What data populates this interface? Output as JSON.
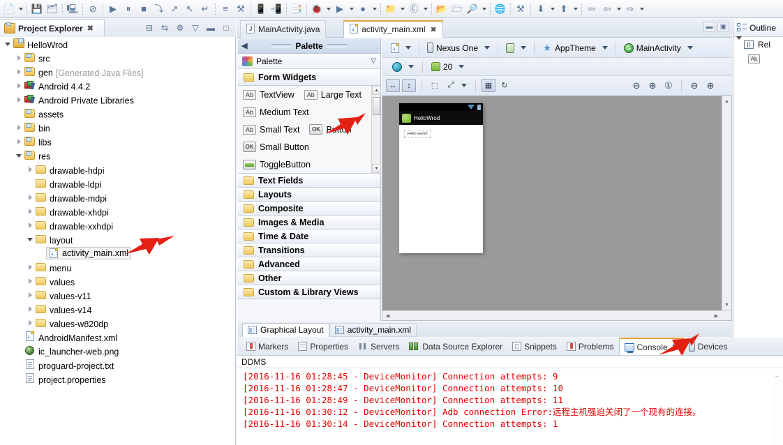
{
  "toolbar": {
    "groups": [
      {
        "items": [
          {
            "name": "new-wizard-icon",
            "glyph": "📄",
            "dropdown": true
          }
        ]
      },
      {
        "items": [
          {
            "name": "save-icon",
            "glyph": "💾",
            "dropdown": false
          },
          {
            "name": "save-all-icon",
            "glyph": "🗂",
            "dropdown": false
          }
        ]
      },
      {
        "items": [
          {
            "name": "print-icon",
            "glyph": "🖳",
            "dropdown": false
          }
        ]
      },
      {
        "items": [
          {
            "name": "toggle-breakpoint-icon",
            "glyph": "⊘",
            "dropdown": false
          }
        ]
      },
      {
        "items": [
          {
            "name": "resume-icon",
            "glyph": "▶",
            "dropdown": false
          },
          {
            "name": "suspend-icon",
            "glyph": "⏸",
            "dropdown": false
          },
          {
            "name": "terminate-icon",
            "glyph": "■",
            "dropdown": false
          },
          {
            "name": "step-into-icon",
            "glyph": "⤵",
            "dropdown": false
          },
          {
            "name": "step-over-icon",
            "glyph": "↗",
            "dropdown": false
          },
          {
            "name": "step-return-icon",
            "glyph": "↖",
            "dropdown": false
          },
          {
            "name": "drop-to-frame-icon",
            "glyph": "↵",
            "dropdown": false
          }
        ]
      },
      {
        "items": [
          {
            "name": "open-perspective-icon",
            "glyph": "≡",
            "dropdown": false
          },
          {
            "name": "android-sdk-manager-icon",
            "glyph": "⚒",
            "dropdown": false
          }
        ]
      },
      {
        "items": [
          {
            "name": "android-virtual-device-manager-icon",
            "glyph": "📱",
            "dropdown": false
          },
          {
            "name": "android-device-icon",
            "glyph": "📲",
            "dropdown": false
          }
        ]
      },
      {
        "items": [
          {
            "name": "new-xml-file-icon",
            "glyph": "📑",
            "dropdown": false
          }
        ]
      },
      {
        "items": [
          {
            "name": "debug-icon",
            "glyph": "🐞",
            "dropdown": true
          },
          {
            "name": "run-icon",
            "glyph": "▶",
            "dropdown": true
          },
          {
            "name": "coverage-icon",
            "glyph": "●",
            "dropdown": true
          }
        ]
      },
      {
        "items": [
          {
            "name": "new-android-project-icon",
            "glyph": "📁",
            "dropdown": true
          },
          {
            "name": "new-java-class-icon",
            "glyph": "Ⓒ",
            "dropdown": true
          }
        ]
      },
      {
        "items": [
          {
            "name": "open-type-icon",
            "glyph": "📂",
            "dropdown": false
          },
          {
            "name": "open-task-icon",
            "glyph": "🗁",
            "dropdown": false
          },
          {
            "name": "search-icon",
            "glyph": "🔎",
            "dropdown": true
          }
        ]
      },
      {
        "items": [
          {
            "name": "web-browser-icon",
            "glyph": "🌐",
            "dropdown": false
          }
        ]
      },
      {
        "items": [
          {
            "name": "run-last-tool-icon",
            "glyph": "⚒",
            "dropdown": false
          }
        ]
      },
      {
        "items": [
          {
            "name": "next-annotation-icon",
            "glyph": "⬇",
            "dropdown": true
          },
          {
            "name": "previous-annotation-icon",
            "glyph": "⬆",
            "dropdown": true
          }
        ]
      },
      {
        "items": [
          {
            "name": "back-icon",
            "glyph": "⇦",
            "dropdown": false
          },
          {
            "name": "previous-edit-icon",
            "glyph": "⇦",
            "dropdown": true
          },
          {
            "name": "forward-icon",
            "glyph": "⇨",
            "dropdown": true
          }
        ]
      }
    ]
  },
  "project_explorer": {
    "tab_label": "Project Explorer",
    "tab_close": "✖",
    "tools": [
      {
        "name": "collapse-all-icon",
        "glyph": "⊟"
      },
      {
        "name": "link-with-editor-icon",
        "glyph": "⇆"
      },
      {
        "name": "view-menu-filter-icon",
        "glyph": "⚙"
      },
      {
        "name": "view-menu-icon",
        "glyph": "▽"
      },
      {
        "name": "minimize-icon",
        "glyph": "▬"
      },
      {
        "name": "maximize-icon",
        "glyph": "□"
      }
    ],
    "tree": [
      {
        "label": "HelloWrod",
        "sub": "",
        "depth": 0,
        "twisty": "open",
        "icon": "android-project-icon",
        "selected": false
      },
      {
        "label": "src",
        "sub": "",
        "depth": 1,
        "twisty": "closed",
        "icon": "source-folder-icon",
        "selected": false
      },
      {
        "label": "gen",
        "sub": "[Generated Java Files]",
        "depth": 1,
        "twisty": "closed",
        "icon": "source-folder-icon",
        "selected": false
      },
      {
        "label": "Android 4.4.2",
        "sub": "",
        "depth": 1,
        "twisty": "closed",
        "icon": "library-icon",
        "selected": false
      },
      {
        "label": "Android Private Libraries",
        "sub": "",
        "depth": 1,
        "twisty": "closed",
        "icon": "library-icon",
        "selected": false
      },
      {
        "label": "assets",
        "sub": "",
        "depth": 1,
        "twisty": "none",
        "icon": "folder-res-icon",
        "selected": false
      },
      {
        "label": "bin",
        "sub": "",
        "depth": 1,
        "twisty": "closed",
        "icon": "folder-res-icon",
        "selected": false
      },
      {
        "label": "libs",
        "sub": "",
        "depth": 1,
        "twisty": "closed",
        "icon": "folder-res-icon",
        "selected": false
      },
      {
        "label": "res",
        "sub": "",
        "depth": 1,
        "twisty": "open",
        "icon": "folder-res-icon",
        "selected": false
      },
      {
        "label": "drawable-hdpi",
        "sub": "",
        "depth": 2,
        "twisty": "closed",
        "icon": "folder-icon",
        "selected": false
      },
      {
        "label": "drawable-ldpi",
        "sub": "",
        "depth": 2,
        "twisty": "none",
        "icon": "folder-icon",
        "selected": false
      },
      {
        "label": "drawable-mdpi",
        "sub": "",
        "depth": 2,
        "twisty": "closed",
        "icon": "folder-icon",
        "selected": false
      },
      {
        "label": "drawable-xhdpi",
        "sub": "",
        "depth": 2,
        "twisty": "closed",
        "icon": "folder-icon",
        "selected": false
      },
      {
        "label": "drawable-xxhdpi",
        "sub": "",
        "depth": 2,
        "twisty": "closed",
        "icon": "folder-icon",
        "selected": false
      },
      {
        "label": "layout",
        "sub": "",
        "depth": 2,
        "twisty": "open",
        "icon": "folder-icon",
        "selected": false
      },
      {
        "label": "activity_main.xml",
        "sub": "",
        "depth": 3,
        "twisty": "none",
        "icon": "xml-file-icon",
        "selected": true
      },
      {
        "label": "menu",
        "sub": "",
        "depth": 2,
        "twisty": "closed",
        "icon": "folder-icon",
        "selected": false
      },
      {
        "label": "values",
        "sub": "",
        "depth": 2,
        "twisty": "closed",
        "icon": "folder-icon",
        "selected": false
      },
      {
        "label": "values-v11",
        "sub": "",
        "depth": 2,
        "twisty": "closed",
        "icon": "folder-icon",
        "selected": false
      },
      {
        "label": "values-v14",
        "sub": "",
        "depth": 2,
        "twisty": "closed",
        "icon": "folder-icon",
        "selected": false
      },
      {
        "label": "values-w820dp",
        "sub": "",
        "depth": 2,
        "twisty": "closed",
        "icon": "folder-icon",
        "selected": false
      },
      {
        "label": "AndroidManifest.xml",
        "sub": "",
        "depth": 1,
        "twisty": "none",
        "icon": "xml-file-icon",
        "selected": false
      },
      {
        "label": "ic_launcher-web.png",
        "sub": "",
        "depth": 1,
        "twisty": "none",
        "icon": "image-file-icon",
        "selected": false
      },
      {
        "label": "proguard-project.txt",
        "sub": "",
        "depth": 1,
        "twisty": "none",
        "icon": "text-file-icon",
        "selected": false
      },
      {
        "label": "project.properties",
        "sub": "",
        "depth": 1,
        "twisty": "none",
        "icon": "text-file-icon",
        "selected": false
      }
    ]
  },
  "editor": {
    "tabs": [
      {
        "label": "MainActivity.java",
        "icon": "java-file-icon",
        "active": false,
        "closable": false
      },
      {
        "label": "activity_main.xml",
        "icon": "xml-file-icon",
        "active": true,
        "closable": true
      }
    ],
    "close_glyph": "✖",
    "window_buttons": [
      {
        "name": "minimize-editor-icon",
        "glyph": "▬"
      },
      {
        "name": "maximize-editor-icon",
        "glyph": "▣"
      }
    ],
    "bottom_tabs": [
      {
        "label": "Graphical Layout",
        "icon": "graphical-layout-icon",
        "active": true
      },
      {
        "label": "activity_main.xml",
        "icon": "xml-source-icon",
        "active": false
      }
    ]
  },
  "palette": {
    "header_title": "Palette",
    "left_arrow": "◀",
    "sub_title": "Palette",
    "sub_menu_glyph": "▽",
    "group_title": "Form Widgets",
    "widgets": [
      [
        {
          "label": "TextView",
          "kind": "ab"
        },
        {
          "label": "Large Text",
          "kind": "ab"
        }
      ],
      [
        {
          "label": "Medium Text",
          "kind": "ab"
        }
      ],
      [
        {
          "label": "Small Text",
          "kind": "ab"
        },
        {
          "label": "Button",
          "kind": "ok"
        }
      ],
      [
        {
          "label": "Small Button",
          "kind": "ok"
        }
      ],
      [
        {
          "label": "ToggleButton",
          "kind": "toggle"
        }
      ]
    ],
    "scroll_up": "▲",
    "scroll_down": "▼",
    "categories": [
      "Text Fields",
      "Layouts",
      "Composite",
      "Images & Media",
      "Time & Date",
      "Transitions",
      "Advanced",
      "Other",
      "Custom & Library Views"
    ]
  },
  "config_bar": {
    "row1": [
      {
        "name": "configuration-chooser-icon",
        "type": "icon-dropdown",
        "icon": "xml-config-icon",
        "label": ""
      },
      {
        "name": "device-selector",
        "type": "labeled-dropdown",
        "icon": "phone-icon",
        "label": "Nexus One"
      },
      {
        "name": "orientation-selector",
        "type": "icon-dropdown",
        "icon": "orientation-icon",
        "label": ""
      },
      {
        "name": "theme-selector",
        "type": "labeled-dropdown",
        "icon": "star-icon",
        "label": "AppTheme"
      },
      {
        "name": "activity-selector",
        "type": "labeled-dropdown",
        "icon": "activity-icon",
        "label": "MainActivity"
      }
    ],
    "row2": [
      {
        "name": "locale-selector",
        "type": "icon-dropdown",
        "icon": "globe-icon",
        "label": ""
      },
      {
        "name": "api-level-selector",
        "type": "labeled-dropdown",
        "icon": "android-icon",
        "label": "20"
      }
    ],
    "row3_left": [
      {
        "name": "toggle-width-fill-button",
        "glyph": "↔",
        "pressed": true
      },
      {
        "name": "toggle-height-fill-button",
        "glyph": "↕",
        "pressed": true
      },
      {
        "name": "show-included-in-button",
        "glyph": "⬚",
        "pressed": false
      },
      {
        "name": "refresh-render-button",
        "glyph": "⤢",
        "pressed": false
      },
      {
        "name": "layout-actions-button",
        "glyph": "▦",
        "pressed": true
      },
      {
        "name": "lint-warnings-button",
        "glyph": "↻",
        "pressed": false
      }
    ],
    "row3_right": [
      {
        "name": "zoom-out-button",
        "glyph": "⊖"
      },
      {
        "name": "zoom-fit-button",
        "glyph": "⊕"
      },
      {
        "name": "zoom-100-button",
        "glyph": "①"
      },
      {
        "name": "zoom-minus-button",
        "glyph": "⊖"
      },
      {
        "name": "zoom-plus-button",
        "glyph": "⊕"
      }
    ]
  },
  "preview": {
    "app_title": "HelloWrod",
    "hello_text": "Hello world!",
    "scroll_up": "▲",
    "scroll_down": "▼",
    "scroll_left": "◀",
    "scroll_right": "▶"
  },
  "console": {
    "tabs": [
      {
        "label": "Markers",
        "icon": "markers-icon",
        "active": false,
        "closable": false
      },
      {
        "label": "Properties",
        "icon": "properties-icon",
        "active": false,
        "closable": false
      },
      {
        "label": "Servers",
        "icon": "servers-icon",
        "active": false,
        "closable": false
      },
      {
        "label": "Data Source Explorer",
        "icon": "datasource-icon",
        "active": false,
        "closable": false
      },
      {
        "label": "Snippets",
        "icon": "snippets-icon",
        "active": false,
        "closable": false
      },
      {
        "label": "Problems",
        "icon": "problems-icon",
        "active": false,
        "closable": false
      },
      {
        "label": "Console",
        "icon": "console-icon",
        "active": true,
        "closable": true
      },
      {
        "label": "Devices",
        "icon": "devices-icon",
        "active": false,
        "closable": false
      }
    ],
    "close_glyph": "✖",
    "title": "DDMS",
    "lines": [
      "[2016-11-16 01:28:45 - DeviceMonitor] Connection attempts: 9",
      "[2016-11-16 01:28:47 - DeviceMonitor] Connection attempts: 10",
      "[2016-11-16 01:28:49 - DeviceMonitor] Connection attempts: 11",
      "[2016-11-16 01:30:12 - DeviceMonitor] Adb connection Error:远程主机强迫关闭了一个现有的连接。",
      "[2016-11-16 01:30:14 - DeviceMonitor] Connection attempts: 1"
    ],
    "log_color": "#e60000",
    "scroll_up_glyph": "→"
  },
  "outline": {
    "tab_label": "Outline",
    "rows": [
      {
        "label": "Rel",
        "depth": 0,
        "twisty": "open",
        "icon": "relative-layout-icon"
      },
      {
        "label": "",
        "depth": 1,
        "twisty": "none",
        "icon": "textview-icon"
      }
    ]
  },
  "annotations": {
    "arrow_color": "#e41f13",
    "arrows": [
      {
        "name": "arrow-to-activity-main-xml"
      },
      {
        "name": "arrow-to-button-widget"
      },
      {
        "name": "arrow-to-console-tab"
      }
    ]
  }
}
